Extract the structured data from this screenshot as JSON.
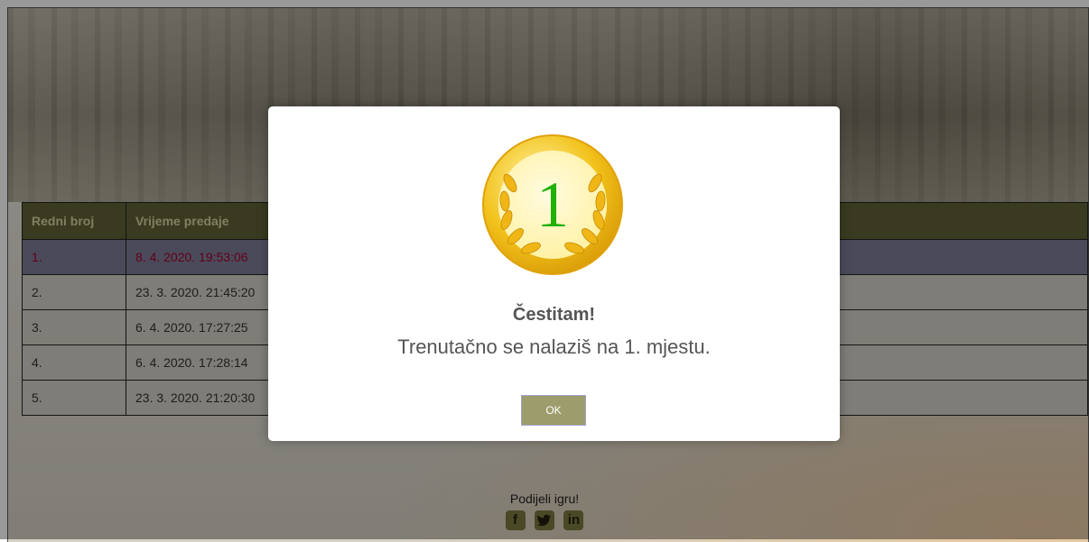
{
  "leaderboard": {
    "headers": [
      "Redni broj",
      "Vrijeme predaje"
    ],
    "rows": [
      {
        "rank": "1.",
        "time": "8. 4. 2020. 19:53:06",
        "highlight": true
      },
      {
        "rank": "2.",
        "time": "23. 3. 2020. 21:45:20"
      },
      {
        "rank": "3.",
        "time": "6. 4. 2020. 17:27:25"
      },
      {
        "rank": "4.",
        "time": "6. 4. 2020. 17:28:14"
      },
      {
        "rank": "5.",
        "time": "23. 3. 2020. 21:20:30"
      }
    ]
  },
  "footer": {
    "share_label": "Podijeli igru!",
    "social_icons": [
      "facebook-icon",
      "twitter-icon",
      "linkedin-icon"
    ],
    "facebook_glyph": "f",
    "linkedin_glyph": "in"
  },
  "modal": {
    "medal_number": "1",
    "title": "Čestitam!",
    "message": "Trenutačno se nalaziš na 1. mjestu.",
    "ok_label": "OK"
  },
  "colors": {
    "header_bg": "#5f6234",
    "highlight_row_bg": "#7d7c97",
    "highlight_text": "#a4002a",
    "button_bg": "#9c9c6c",
    "medal_gold": "#f2c21b"
  }
}
